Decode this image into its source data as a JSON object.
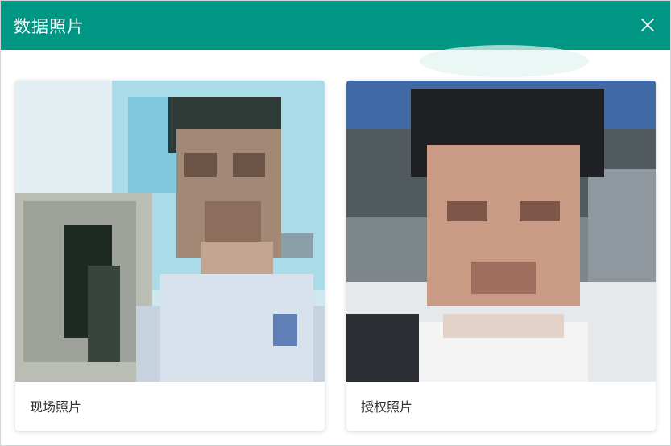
{
  "dialog": {
    "title": "数据照片",
    "close_icon": "close-icon"
  },
  "cards": [
    {
      "caption": "现场照片",
      "photo": "pixelated-face-photo"
    },
    {
      "caption": "授权照片",
      "photo": "pixelated-face-photo"
    }
  ],
  "colors": {
    "header": "#009684",
    "header_text": "#ffffff",
    "caption_text": "#333333"
  }
}
